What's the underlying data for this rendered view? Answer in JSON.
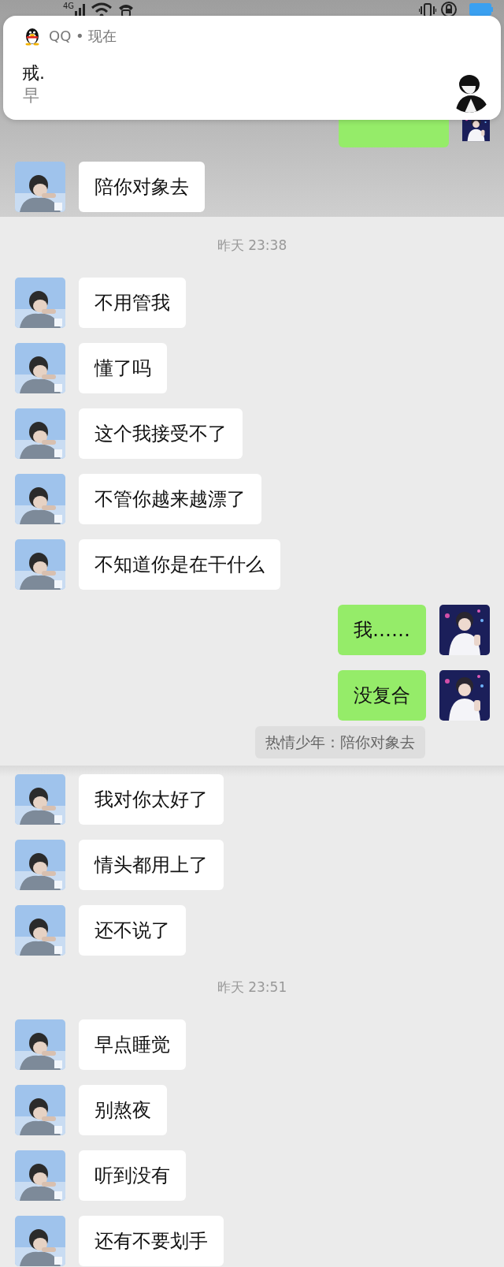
{
  "status_bar": {
    "network": "4G"
  },
  "notification": {
    "app": "QQ",
    "separator": "•",
    "when": "现在",
    "sender": "戒.",
    "message": "早"
  },
  "sections": [
    {
      "dimmed": true,
      "items": [
        {
          "kind": "out-covered"
        },
        {
          "kind": "in",
          "text": "陪你对象去"
        }
      ]
    },
    {
      "dimmed": false,
      "items": [
        {
          "kind": "time",
          "text": "昨天 23:38"
        },
        {
          "kind": "in",
          "text": "不用管我"
        },
        {
          "kind": "in",
          "text": "懂了吗"
        },
        {
          "kind": "in",
          "text": "这个我接受不了"
        },
        {
          "kind": "in",
          "text": "不管你越来越漂了"
        },
        {
          "kind": "in",
          "text": "不知道你是在干什么"
        },
        {
          "kind": "out",
          "text": "我……"
        },
        {
          "kind": "out",
          "text": "没复合"
        },
        {
          "kind": "quote",
          "text": "热情少年：陪你对象去"
        }
      ]
    },
    {
      "dimmed": false,
      "items": [
        {
          "kind": "in",
          "text": "我对你太好了"
        },
        {
          "kind": "in",
          "text": "情头都用上了"
        },
        {
          "kind": "in",
          "text": "还不说了"
        },
        {
          "kind": "time",
          "text": "昨天 23:51"
        },
        {
          "kind": "in",
          "text": "早点睡觉"
        },
        {
          "kind": "in",
          "text": "别熬夜"
        },
        {
          "kind": "in",
          "text": "听到没有"
        },
        {
          "kind": "in",
          "text": "还有不要划手"
        }
      ]
    }
  ]
}
